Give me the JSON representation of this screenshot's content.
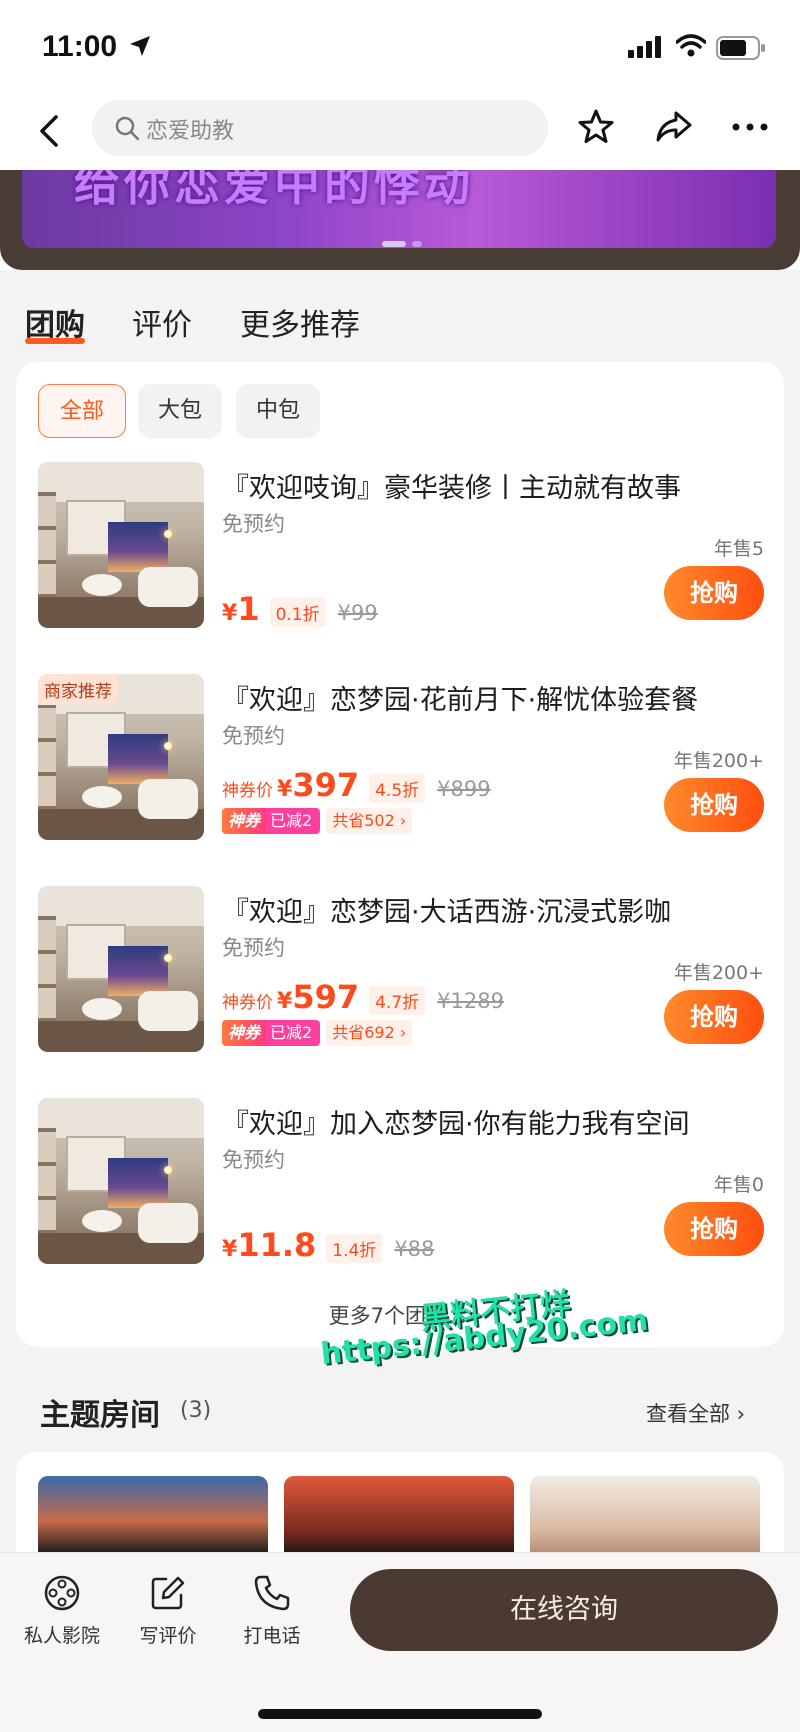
{
  "status": {
    "time": "11:00"
  },
  "search": {
    "placeholder": "恋爱助教"
  },
  "banner": {
    "text": "给你恋爱中的悸动"
  },
  "tabs": [
    "团购",
    "评价",
    "更多推荐"
  ],
  "filters": [
    "全部",
    "大包",
    "中包"
  ],
  "deals": [
    {
      "title": "『欢迎吱询』豪华装修丨主动就有故事",
      "sub": "免预约",
      "yen": "¥",
      "price": "1",
      "discount": "0.1折",
      "original": "¥99",
      "sold": "年售5",
      "buy": "抢购"
    },
    {
      "title": "『欢迎』恋梦园·花前月下·解忧体验套餐",
      "sub": "免预约",
      "tag": "商家推荐",
      "price_label": "神券价",
      "yen": "¥",
      "price": "397",
      "discount": "4.5折",
      "original": "¥899",
      "coupon_a": "神券",
      "coupon_b": "已减2",
      "coupon_c": "共省502 ›",
      "sold": "年售200+",
      "buy": "抢购"
    },
    {
      "title": "『欢迎』恋梦园·大话西游·沉浸式影咖",
      "sub": "免预约",
      "price_label": "神券价",
      "yen": "¥",
      "price": "597",
      "discount": "4.7折",
      "original": "¥1289",
      "coupon_a": "神券",
      "coupon_b": "已减2",
      "coupon_c": "共省692 ›",
      "sold": "年售200+",
      "buy": "抢购"
    },
    {
      "title": "『欢迎』加入恋梦园·你有能力我有空间",
      "sub": "免预约",
      "yen": "¥",
      "price": "11.8",
      "discount": "1.4折",
      "original": "¥88",
      "sold": "年售0",
      "buy": "抢购"
    }
  ],
  "more_deals": "更多7个团购 ⌄",
  "theme_rooms": {
    "title": "主题房间",
    "count": "(3)",
    "view_all": "查看全部 ›"
  },
  "watermark": {
    "line1": "黑料不打烊",
    "line2": "https://abdy20.com"
  },
  "bottom_bar": {
    "items": [
      "私人影院",
      "写评价",
      "打电话"
    ],
    "consult": "在线咨询"
  },
  "icons": [
    "location-arrow-icon",
    "signal-icon",
    "wifi-icon",
    "battery-icon",
    "back-icon",
    "search-icon",
    "star-icon",
    "share-icon",
    "more-icon",
    "film-reel-icon",
    "edit-review-icon",
    "phone-icon"
  ],
  "colors": {
    "accent": "#ff5a1f",
    "consult": "#4b3a31"
  }
}
